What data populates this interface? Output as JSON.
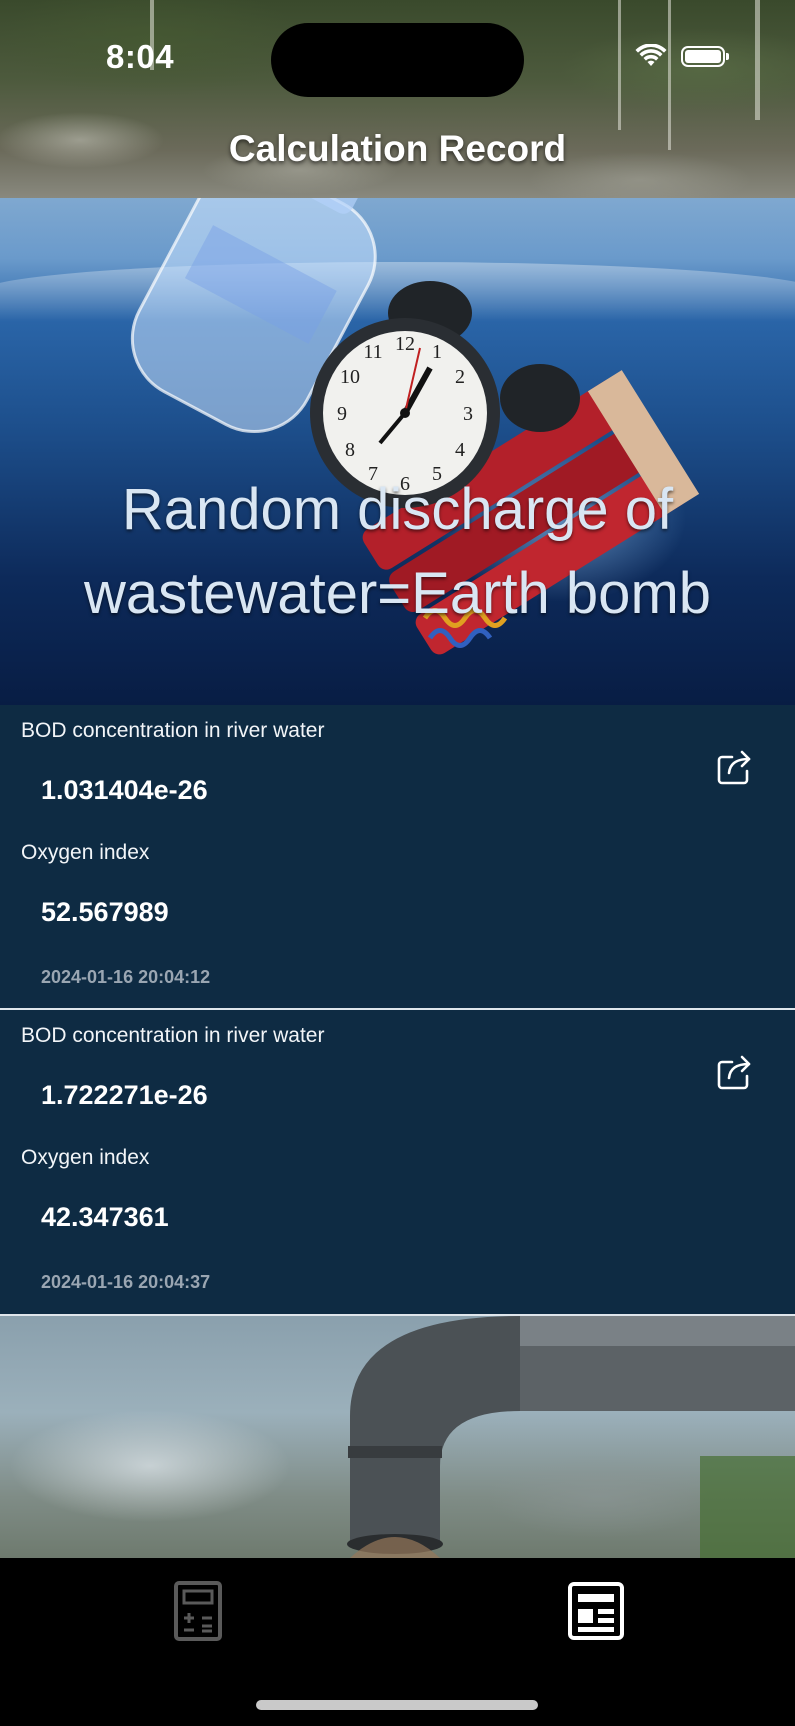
{
  "status_bar": {
    "time": "8:04"
  },
  "header": {
    "title": "Calculation Record"
  },
  "banner": {
    "caption_line1": "Random discharge of",
    "caption_line2": "wastewater=Earth bomb"
  },
  "records": [
    {
      "bod_label": "BOD concentration in river water",
      "bod_value": "1.031404e-26",
      "oxygen_label": "Oxygen index",
      "oxygen_value": "52.567989",
      "timestamp": "2024-01-16 20:04:12"
    },
    {
      "bod_label": "BOD concentration in river water",
      "bod_value": "1.722271e-26",
      "oxygen_label": "Oxygen index",
      "oxygen_value": "42.347361",
      "timestamp": "2024-01-16 20:04:37"
    }
  ],
  "icons": {
    "share": "share-icon",
    "calculator_tab": "calculator-icon",
    "records_tab": "records-icon",
    "wifi": "wifi-icon",
    "battery": "battery-icon"
  },
  "tabs": [
    {
      "name": "calculator",
      "selected": false
    },
    {
      "name": "records",
      "selected": true
    }
  ],
  "colors": {
    "record_background": "#0e2b43",
    "tab_bar_background": "#000000",
    "tab_active": "#ffffff",
    "tab_inactive": "#5a5a5a",
    "timestamp": "#9aa6b2"
  }
}
